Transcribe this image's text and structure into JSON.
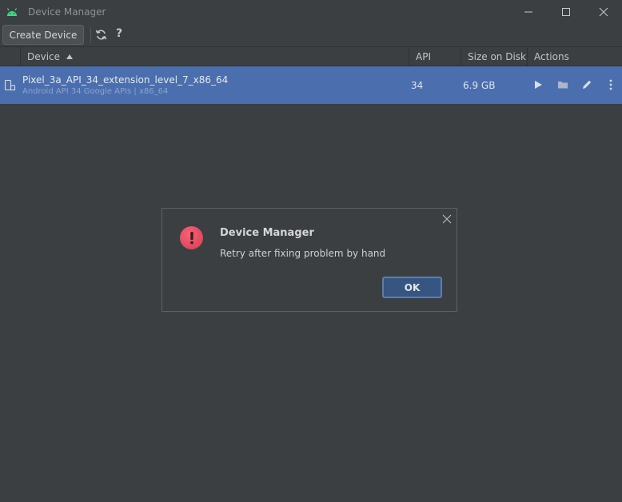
{
  "window": {
    "title": "Device Manager",
    "icons": {
      "app": "android-icon",
      "minimize": "minimize-icon",
      "maximize": "maximize-icon",
      "close": "close-icon"
    }
  },
  "toolbar": {
    "create_label": "Create Device",
    "refresh_icon": "refresh-icon",
    "help_label": "?"
  },
  "table": {
    "columns": [
      "Device",
      "API",
      "Size on Disk",
      "Actions"
    ],
    "sort_column": "Device",
    "sort_direction": "ascending",
    "rows": [
      {
        "name": "Pixel_3a_API_34_extension_level_7_x86_64",
        "subtitle": "Android API 34 Google APIs | x86_64",
        "api": "34",
        "size": "6.9 GB",
        "actions": [
          "play-icon",
          "folder-icon",
          "edit-icon",
          "more-icon"
        ]
      }
    ]
  },
  "dialog": {
    "title": "Device Manager",
    "message": "Retry after fixing problem by hand",
    "ok_label": "OK",
    "icon": "error-icon"
  },
  "colors": {
    "background": "#3c3f41",
    "selection": "#4b6eaf",
    "error": "#e0485d",
    "android_green": "#3ddc84"
  }
}
